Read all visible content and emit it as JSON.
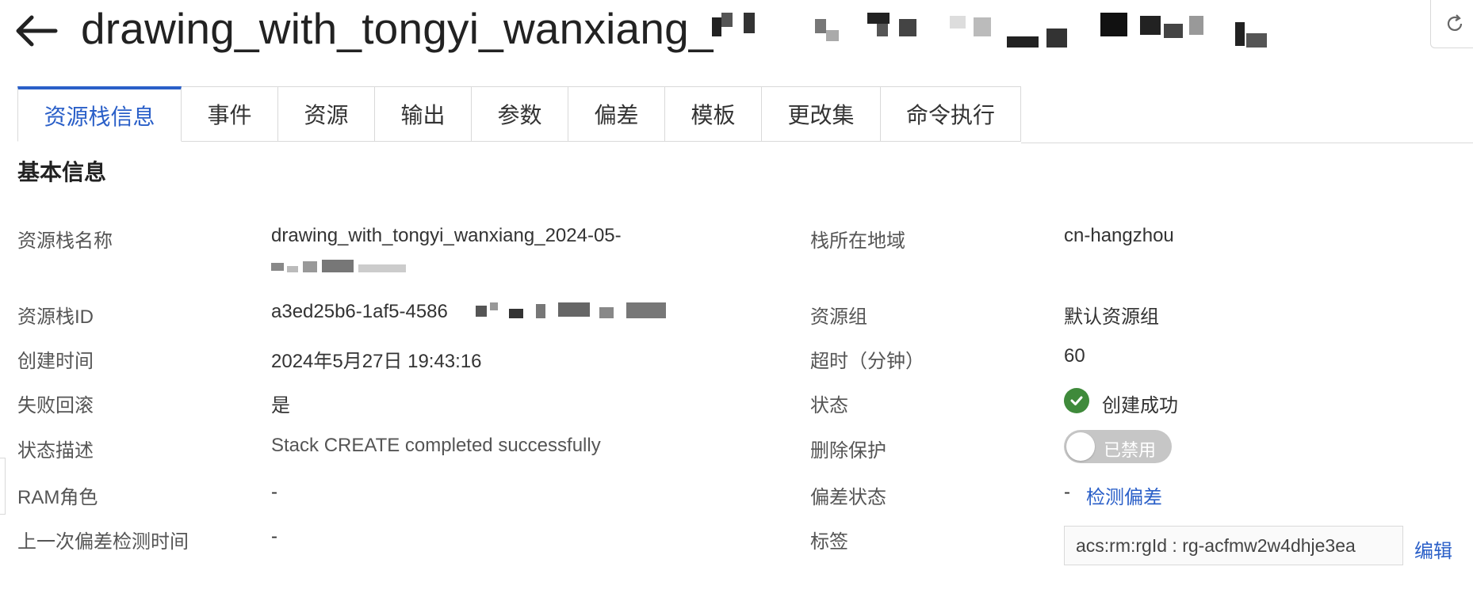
{
  "header": {
    "title": "drawing_with_tongyi_wanxiang_"
  },
  "tabs": [
    {
      "label": "资源栈信息",
      "active": true
    },
    {
      "label": "事件"
    },
    {
      "label": "资源"
    },
    {
      "label": "输出"
    },
    {
      "label": "参数"
    },
    {
      "label": "偏差"
    },
    {
      "label": "模板"
    },
    {
      "label": "更改集"
    },
    {
      "label": "命令执行"
    }
  ],
  "section": {
    "title": "基本信息"
  },
  "left_fields": {
    "stack_name_label": "资源栈名称",
    "stack_name_value": "drawing_with_tongyi_wanxiang_2024-05-",
    "stack_id_label": "资源栈ID",
    "stack_id_value": "a3ed25b6-1af5-4586",
    "created_label": "创建时间",
    "created_value": "2024年5月27日 19:43:16",
    "rollback_label": "失败回滚",
    "rollback_value": "是",
    "status_desc_label": "状态描述",
    "status_desc_value": "Stack CREATE completed successfully",
    "ram_label": "RAM角色",
    "ram_value": "-",
    "last_drift_label": "上一次偏差检测时间",
    "last_drift_value": "-"
  },
  "right_fields": {
    "region_label": "栈所在地域",
    "region_value": "cn-hangzhou",
    "resource_group_label": "资源组",
    "resource_group_value": "默认资源组",
    "timeout_label": "超时（分钟）",
    "timeout_value": "60",
    "status_label": "状态",
    "status_value": "创建成功",
    "deletion_protection_label": "删除保护",
    "deletion_protection_value": "已禁用",
    "drift_status_label": "偏差状态",
    "drift_status_value": "-",
    "drift_detect_link": "检测偏差",
    "tags_label": "标签",
    "tag_value": "acs:rm:rgId : rg-acfmw2w4dhje3ea",
    "tags_edit_link": "编辑"
  },
  "colors": {
    "accent": "#2a5fc8",
    "success": "#3f8a3b",
    "toggle_off": "#c6c6c6"
  },
  "icons": {
    "back": "arrow-left-icon",
    "refresh": "refresh-icon",
    "status": "check-circle-icon"
  }
}
